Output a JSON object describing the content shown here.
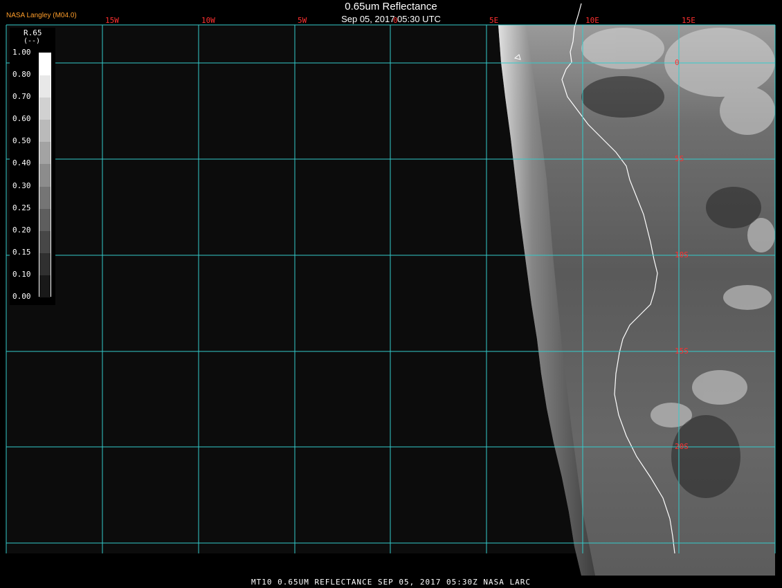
{
  "header": {
    "title": "0.65um Reflectance",
    "timestamp": "Sep 05, 2017 05:30 UTC",
    "provider": "NASA Langley (M04.0)"
  },
  "legend": {
    "title": "R.65",
    "units": "(--)",
    "labels": [
      "1.00",
      "0.80",
      "0.70",
      "0.60",
      "0.50",
      "0.40",
      "0.30",
      "0.25",
      "0.20",
      "0.15",
      "0.10",
      "0.00"
    ]
  },
  "map": {
    "lon_labels": [
      "15W",
      "10W",
      "5W",
      "0",
      "5E",
      "10E",
      "15E"
    ],
    "lat_labels": [
      "0",
      "5S",
      "10S",
      "15S",
      "20S"
    ],
    "colors": {
      "grid": "#33cccc",
      "grid_label": "#ff3030",
      "coastline": "#ffffff",
      "space": "#0c0c0c"
    }
  },
  "footer": {
    "caption": "MT10  0.65UM REFLECTANCE   SEP 05, 2017 05:30Z   NASA LARC"
  }
}
